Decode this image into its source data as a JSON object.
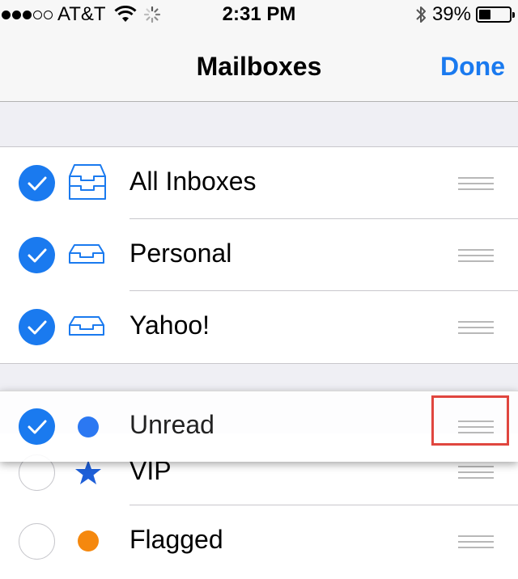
{
  "status_bar": {
    "carrier": "AT&T",
    "time": "2:31 PM",
    "battery": "39%",
    "battery_level": 0.39,
    "signal_bars": 3,
    "signal_total": 5,
    "icons": [
      "wifi-icon",
      "activity-spinner-icon",
      "bluetooth-icon",
      "battery-icon"
    ]
  },
  "nav": {
    "title": "Mailboxes",
    "done": "Done"
  },
  "accounts": [
    {
      "label": "All Inboxes",
      "checked": true,
      "icon": "inbox-tray-icon"
    },
    {
      "label": "Personal",
      "checked": true,
      "icon": "inbox-tray-icon"
    },
    {
      "label": "Yahoo!",
      "checked": true,
      "icon": "inbox-tray-icon"
    }
  ],
  "smart_mailboxes": [
    {
      "label": "Unread",
      "checked": true,
      "icon": "blue-dot-icon",
      "state": "dragging"
    },
    {
      "label": "VIP",
      "checked": false,
      "icon": "star-icon"
    },
    {
      "label": "Flagged",
      "checked": false,
      "icon": "orange-dot-icon"
    }
  ],
  "colors": {
    "accent": "#1a7aef",
    "unread_dot": "#2b78f2",
    "vip_star": "#1e5fd8",
    "flagged_dot": "#f5880e",
    "annotation": "#e0463f"
  }
}
